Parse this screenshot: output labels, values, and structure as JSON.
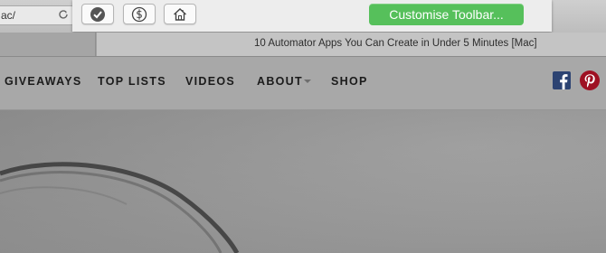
{
  "toolbar": {
    "url_text": "ac/",
    "done_label": "Customise Toolbar...",
    "buttons": [
      {
        "icon": "checkmark-circle-icon"
      },
      {
        "icon": "dollar-circle-icon"
      },
      {
        "icon": "home-icon"
      }
    ]
  },
  "tab": {
    "title": "10 Automator Apps You Can Create in Under 5 Minutes [Mac]"
  },
  "nav": {
    "items": [
      "GIVEAWAYS",
      "TOP LISTS",
      "VIDEOS",
      "ABOUT",
      "SHOP"
    ],
    "social": [
      "facebook-icon",
      "pinterest-icon"
    ]
  },
  "colors": {
    "done_button": "#56c05b",
    "facebook": "#2c4372",
    "pinterest": "#9e1123"
  }
}
